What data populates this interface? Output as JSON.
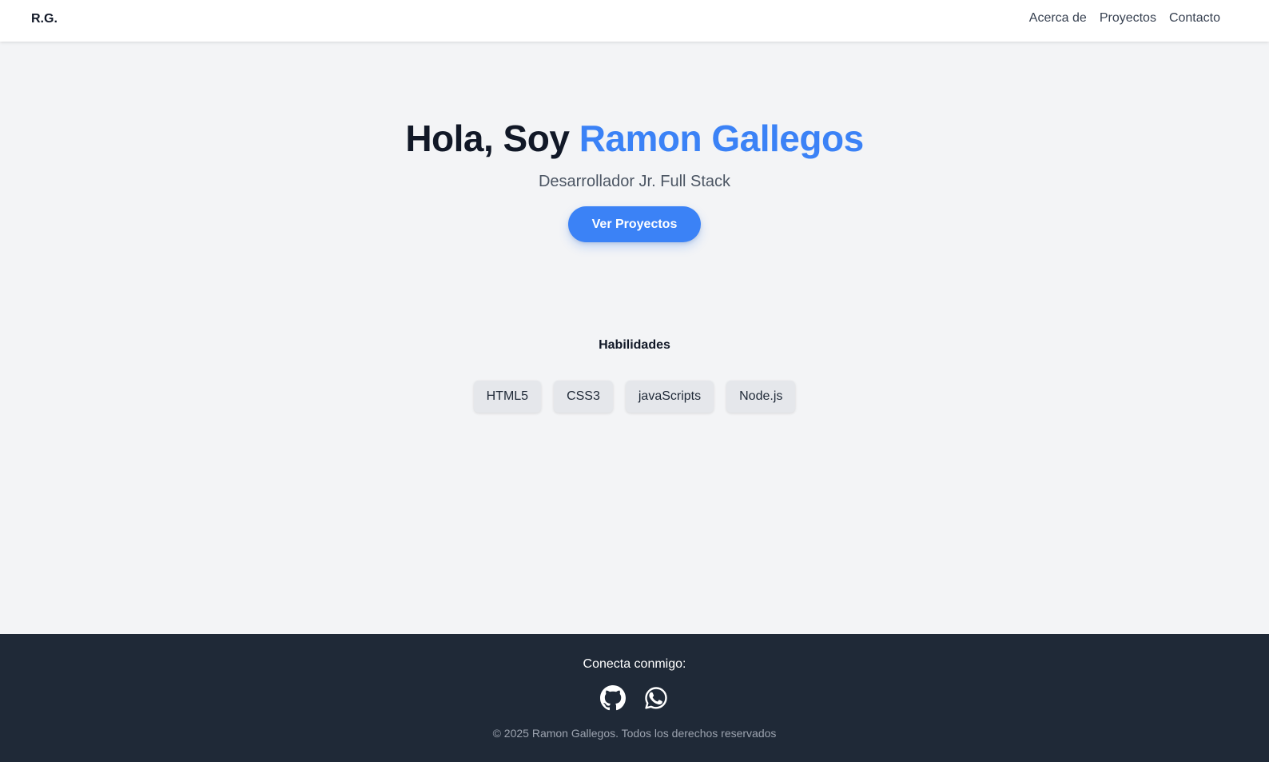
{
  "header": {
    "logo": "R.G.",
    "nav": [
      {
        "label": "Acerca de"
      },
      {
        "label": "Proyectos"
      },
      {
        "label": "Contacto"
      }
    ]
  },
  "hero": {
    "greeting": "Hola, Soy ",
    "name": "Ramon Gallegos",
    "subtitle": "Desarrollador Jr. Full Stack",
    "cta_label": "Ver Proyectos"
  },
  "skills": {
    "title": "Habilidades",
    "items": [
      "HTML5",
      "CSS3",
      "javaScripts",
      "Node.js"
    ]
  },
  "footer": {
    "connect_label": "Conecta conmigo:",
    "social": [
      {
        "icon": "github-icon"
      },
      {
        "icon": "whatsapp-icon"
      }
    ],
    "copyright": "© 2025 Ramon Gallegos. Todos los derechos reservados"
  },
  "colors": {
    "accent": "#3b82f6",
    "background": "#f3f4f6",
    "footer_bg": "#1f2937",
    "chip_bg": "#e5e7eb"
  }
}
